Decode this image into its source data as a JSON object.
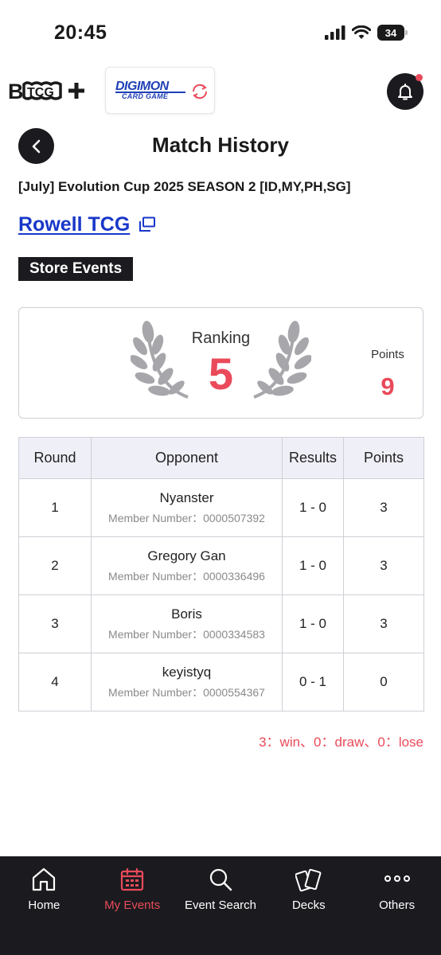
{
  "status_bar": {
    "time": "20:45",
    "battery": "34"
  },
  "header": {
    "bandai_logo_text": "B TCG+",
    "digimon_logo_text": "DIGIMON",
    "digimon_logo_subtext": "CARD GAME",
    "bell_icon": "bell-icon",
    "has_notification": true
  },
  "page": {
    "title": "Match History",
    "event_name": "[July] Evolution Cup 2025 SEASON 2 [ID,MY,PH,SG]",
    "store_name": "Rowell TCG",
    "tag": "Store Events"
  },
  "ranking": {
    "label": "Ranking",
    "value": "5",
    "points_label": "Points",
    "points_value": "9"
  },
  "table": {
    "headers": [
      "Round",
      "Opponent",
      "Results",
      "Points"
    ],
    "rows": [
      {
        "round": "1",
        "opponent": "Nyanster",
        "member": "Member Number：0000507392",
        "result": "1 - 0",
        "points": "3"
      },
      {
        "round": "2",
        "opponent": "Gregory Gan",
        "member": "Member Number：0000336496",
        "result": "1 - 0",
        "points": "3"
      },
      {
        "round": "3",
        "opponent": "Boris",
        "member": "Member Number：0000334583",
        "result": "1 - 0",
        "points": "3"
      },
      {
        "round": "4",
        "opponent": "keyistyq",
        "member": "Member Number：0000554367",
        "result": "0 - 1",
        "points": "0"
      }
    ]
  },
  "legend": "3：win、0：draw、0：lose",
  "colors": {
    "accent": "#ea4a5a",
    "dark": "#1b1b1f",
    "link": "#1837c9",
    "table_header": "#efeff7"
  },
  "nav": {
    "items": [
      {
        "label": "Home",
        "icon": "home-icon",
        "active": false
      },
      {
        "label": "My Events",
        "icon": "calendar-icon",
        "active": true
      },
      {
        "label": "Event Search",
        "icon": "search-icon",
        "active": false
      },
      {
        "label": "Decks",
        "icon": "cards-icon",
        "active": false
      },
      {
        "label": "Others",
        "icon": "more-icon",
        "active": false
      }
    ]
  }
}
